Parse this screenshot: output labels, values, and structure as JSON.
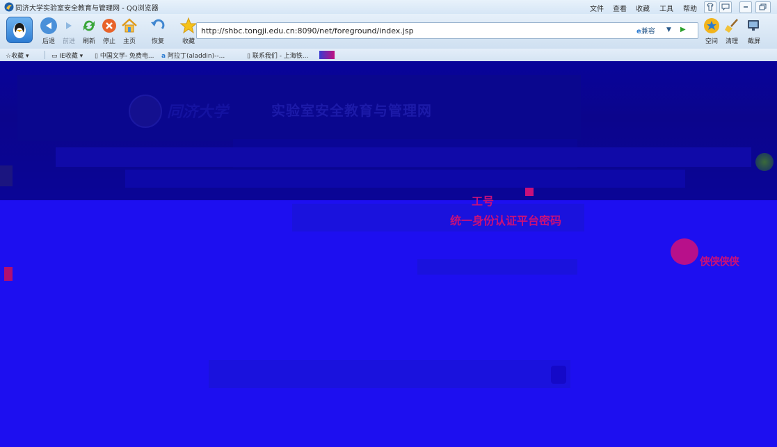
{
  "window": {
    "title": "同济大学实验室安全教育与管理网 - QQ浏览器",
    "menu": [
      "文件",
      "查看",
      "收藏",
      "工具",
      "帮助"
    ]
  },
  "toolbar": {
    "buttons": [
      {
        "label": "后退",
        "icon": "back-arrow-icon"
      },
      {
        "label": "前进",
        "icon": "forward-arrow-icon"
      },
      {
        "label": "刷新",
        "icon": "refresh-icon"
      },
      {
        "label": "停止",
        "icon": "stop-icon"
      },
      {
        "label": "主页",
        "icon": "home-icon"
      },
      {
        "label": "恢复",
        "icon": "restore-icon"
      },
      {
        "label": "收藏",
        "icon": "star-icon"
      }
    ],
    "right_buttons": [
      {
        "label": "空间",
        "icon": "qzone-icon"
      },
      {
        "label": "清理",
        "icon": "broom-icon"
      },
      {
        "label": "截屏",
        "icon": "screenshot-icon"
      }
    ],
    "address": "http://shbc.tongji.edu.cn:8090/net/foreground/index.jsp",
    "compat_label": "兼容"
  },
  "favorites": {
    "items": [
      "收藏",
      "IE收藏",
      "中国文学- 免费电...",
      "阿拉丁(aladdin)--...",
      "联系我们 - 上海铁..."
    ]
  },
  "page": {
    "site_title": "实验室安全教育与管理网",
    "university": "同济大学",
    "login_id_label": "工号",
    "login_pwd_label": "统一身份认证平台密码",
    "mascot_text": "侠侠侠侠"
  },
  "colors": {
    "page_bg": "#1d0ff0",
    "header_bg": "#08049a",
    "highlight": "#c8107a"
  }
}
